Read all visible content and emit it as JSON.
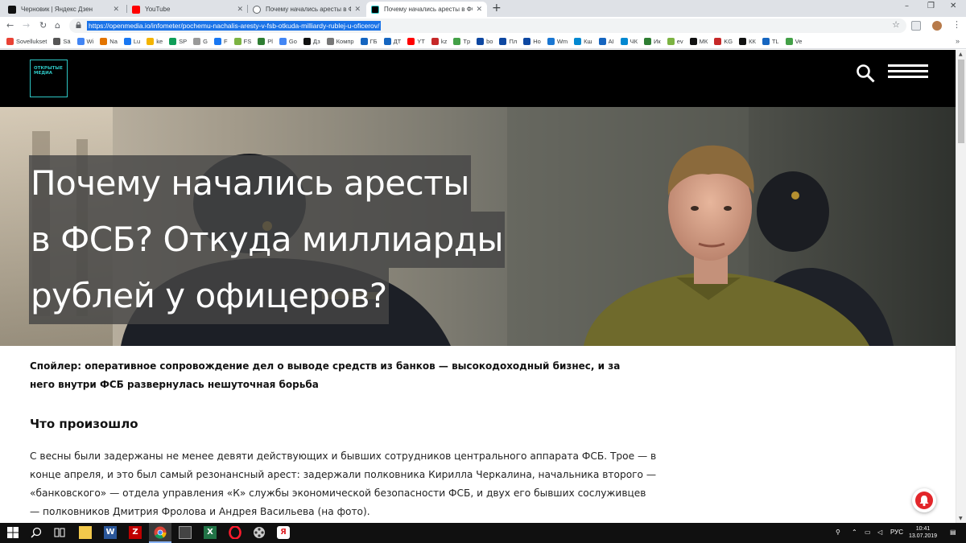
{
  "browser": {
    "tabs": [
      {
        "title": "Черновик | Яндекс Дзен",
        "active": false,
        "icon": "plus-square-icon"
      },
      {
        "title": "YouTube",
        "active": false,
        "icon": "youtube-icon"
      },
      {
        "title": "Почему начались аресты в ФСБ",
        "active": false,
        "icon": "globe-icon"
      },
      {
        "title": "Почему начались аресты в ФСБ",
        "active": true,
        "icon": "openmedia-icon"
      }
    ],
    "new_tab_label": "+",
    "window_controls": {
      "minimize": "–",
      "maximize": "❐",
      "close": "✕"
    },
    "url": "https://openmedia.io/infometer/pochemu-nachalis-aresty-v-fsb-otkuda-milliardy-rublej-u-oficerov/",
    "nav": {
      "back": "←",
      "forward": "→",
      "reload": "↻",
      "home": "⌂"
    },
    "bookmarks": [
      {
        "label": "Sovellukset",
        "color": "#e94235"
      },
      {
        "label": "Sä",
        "color": "#555555"
      },
      {
        "label": "Wi",
        "color": "#4285f4"
      },
      {
        "label": "Na",
        "color": "#e37400"
      },
      {
        "label": "Lu",
        "color": "#1877f2"
      },
      {
        "label": "ke",
        "color": "#f4b400"
      },
      {
        "label": "SP",
        "color": "#0f9d58"
      },
      {
        "label": "G",
        "color": "#999999"
      },
      {
        "label": "F",
        "color": "#1877f2"
      },
      {
        "label": "FS",
        "color": "#7cb342"
      },
      {
        "label": "Pl",
        "color": "#2e7d32"
      },
      {
        "label": "Go",
        "color": "#4285f4"
      },
      {
        "label": "Дз",
        "color": "#111111"
      },
      {
        "label": "Компр",
        "color": "#777777"
      },
      {
        "label": "ГБ",
        "color": "#1565c0"
      },
      {
        "label": "ДТ",
        "color": "#1565c0"
      },
      {
        "label": "YT",
        "color": "#ff0000"
      },
      {
        "label": "kz",
        "color": "#c62828"
      },
      {
        "label": "Tp",
        "color": "#43a047"
      },
      {
        "label": "bo",
        "color": "#0d47a1"
      },
      {
        "label": "Пл",
        "color": "#0d47a1"
      },
      {
        "label": "Но",
        "color": "#0d47a1"
      },
      {
        "label": "Wm",
        "color": "#1976d2"
      },
      {
        "label": "Кш",
        "color": "#0288d1"
      },
      {
        "label": "AI",
        "color": "#1565c0"
      },
      {
        "label": "ЧК",
        "color": "#0288d1"
      },
      {
        "label": "Ик",
        "color": "#2e7d32"
      },
      {
        "label": "ev",
        "color": "#7cb342"
      },
      {
        "label": "МК",
        "color": "#111111"
      },
      {
        "label": "KG",
        "color": "#c62828"
      },
      {
        "label": "КК",
        "color": "#111111"
      },
      {
        "label": "TL",
        "color": "#1565c0"
      },
      {
        "label": "Ve",
        "color": "#43a047"
      }
    ],
    "bookmarks_more": "»"
  },
  "site": {
    "logo_text": "открытые медиа",
    "accent": "#2ec7c5"
  },
  "article": {
    "title_lines": [
      "Почему начались аресты",
      "в ФСБ? Откуда миллиарды",
      "рублей у офицеров?"
    ],
    "lead": "Спойлер: оперативное сопровождение дел о выводе средств из банков — высокодоходный бизнес, и за него внутри ФСБ развернулась нешуточная борьба",
    "section_heading": "Что произошло",
    "body": "С весны были задержаны не менее девяти действующих и бывших сотрудников центрального аппарата ФСБ. Трое — в конце апреля, и это был самый резонансный арест: задержали полковника Кирилла Черкалина, начальника второго — «банковского» — отдела управления «К» службы экономической безопасности ФСБ, и двух его бывших сослуживцев — полковников Дмитрия Фролова и Андрея Васильева (на фото)."
  },
  "taskbar": {
    "language": "РУС",
    "time": "10:41",
    "date": "13.07.2019",
    "apps": [
      "windows-start-icon",
      "search-icon",
      "task-view-icon",
      "file-explorer-icon",
      "word-icon",
      "filezilla-icon",
      "chrome-icon",
      "calculator-icon",
      "excel-icon",
      "opera-icon",
      "film-reel-icon",
      "yandex-browser-icon"
    ]
  }
}
